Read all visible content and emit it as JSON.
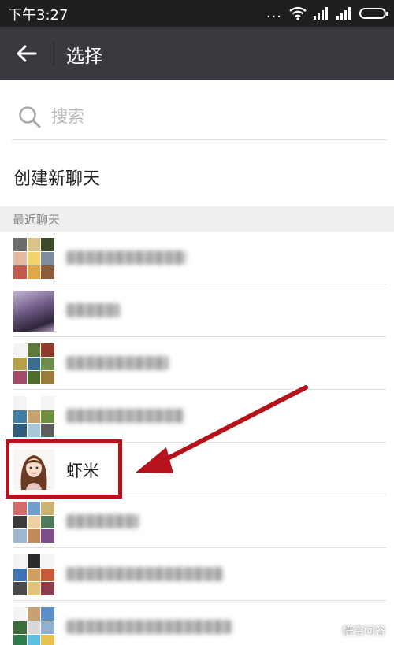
{
  "status_bar": {
    "time": "下午3:27",
    "dots": "..."
  },
  "header": {
    "back_icon": "arrow-left-icon",
    "title": "选择"
  },
  "search": {
    "placeholder": "搜索",
    "icon": "search-icon"
  },
  "new_chat": {
    "label": "创建新聊天"
  },
  "recent_section": {
    "label": "最近聊天"
  },
  "contacts": [
    {
      "avatar_type": "group-grid",
      "name_visible": false
    },
    {
      "avatar_type": "single-photo",
      "name_visible": false
    },
    {
      "avatar_type": "group-grid",
      "name_visible": false
    },
    {
      "avatar_type": "group-grid",
      "name_visible": false
    },
    {
      "avatar_type": "single-illustration",
      "name_visible": true,
      "name": "虾米",
      "highlighted": true
    },
    {
      "avatar_type": "group-grid",
      "name_visible": false
    },
    {
      "avatar_type": "group-grid",
      "name_visible": false
    },
    {
      "avatar_type": "group-grid",
      "name_visible": false,
      "name_first_char": "新"
    }
  ],
  "annotation": {
    "box_color": "#b5121b",
    "arrow_color": "#b5121b"
  },
  "colors": {
    "status_bar": "#1f1f1f",
    "title_bar": "#393a3f",
    "section_bg": "#efefef",
    "accent_red": "#b5121b"
  },
  "watermark": {
    "text": "悟空问答"
  }
}
